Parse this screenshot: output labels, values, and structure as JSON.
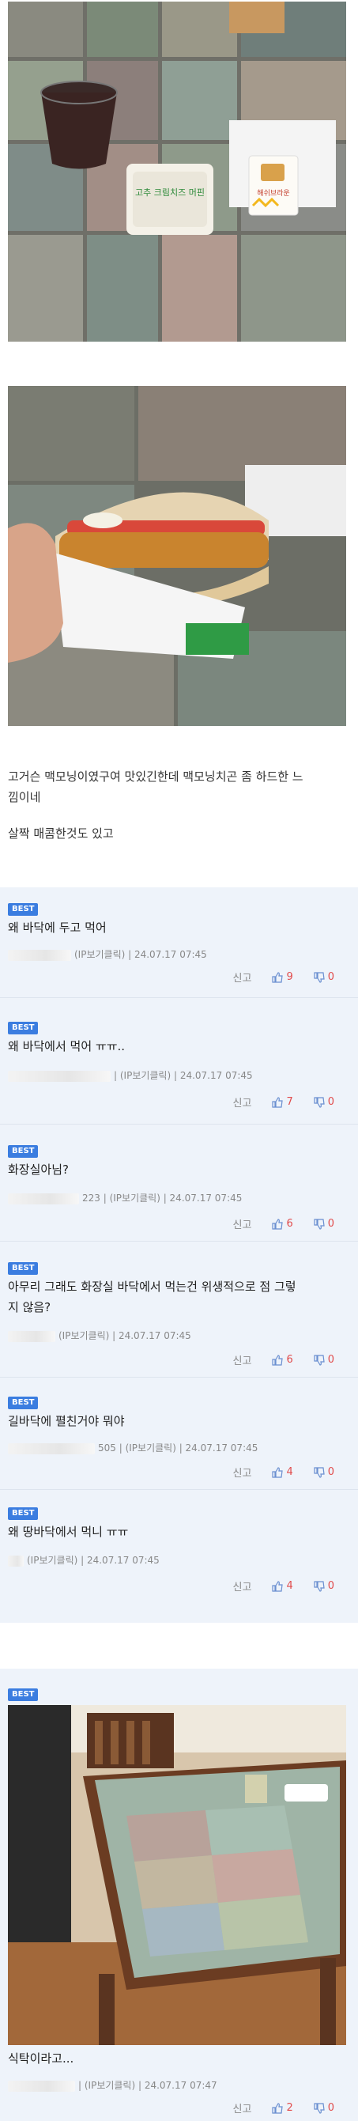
{
  "post": {
    "lines": [
      "고거슨 맥모닝이였구여 맛있긴한데 맥모닝치곤 좀 하드한 느",
      "낌이네",
      "살짝 매콤한것도 있고"
    ]
  },
  "photo1": {
    "cup_label": "",
    "box_label": "고추 크림치즈 머핀",
    "hashbrown_label": "해쉬브라운"
  },
  "comments": [
    {
      "badge": "BEST",
      "text": "왜 바닥에 두고 먹어",
      "meta": "(IP보기클릭) | 24.07.17 07:45",
      "reply": "신고",
      "up": "9",
      "down": "0"
    },
    {
      "badge": "BEST",
      "text": "왜 바닥에서 먹어 ㅠㅠ..",
      "meta": "| (IP보기클릭) | 24.07.17 07:45",
      "reply": "신고",
      "up": "7",
      "down": "0"
    },
    {
      "badge": "BEST",
      "text": "화장실아님?",
      "meta": "223 | (IP보기클릭) | 24.07.17 07:45",
      "reply": "신고",
      "up": "6",
      "down": "0"
    },
    {
      "badge": "BEST",
      "text1": "아무리 그래도 화장실 바닥에서 먹는건 위생적으로 점 그렇",
      "text2": "지 않음?",
      "meta": "(IP보기클릭) | 24.07.17 07:45",
      "reply": "신고",
      "up": "6",
      "down": "0"
    },
    {
      "badge": "BEST",
      "text": "길바닥에 펼친거야 뭐야",
      "meta": "505 | (IP보기클릭) | 24.07.17 07:45",
      "reply": "신고",
      "up": "4",
      "down": "0"
    },
    {
      "badge": "BEST",
      "text": "왜 땅바닥에서 먹니 ㅠㅠ",
      "meta": "(IP보기클릭) | 24.07.17 07:45",
      "reply": "신고",
      "up": "4",
      "down": "0"
    }
  ],
  "last": {
    "badge": "BEST",
    "text": "식탁이라고...",
    "meta": "| (IP보기클릭) | 24.07.17 07:47",
    "reply": "신고",
    "up": "2",
    "down": "0"
  },
  "colors": {
    "accent": "#3b7de0",
    "vote": "#e14b4b",
    "comment_bg": "#eef3fa"
  }
}
